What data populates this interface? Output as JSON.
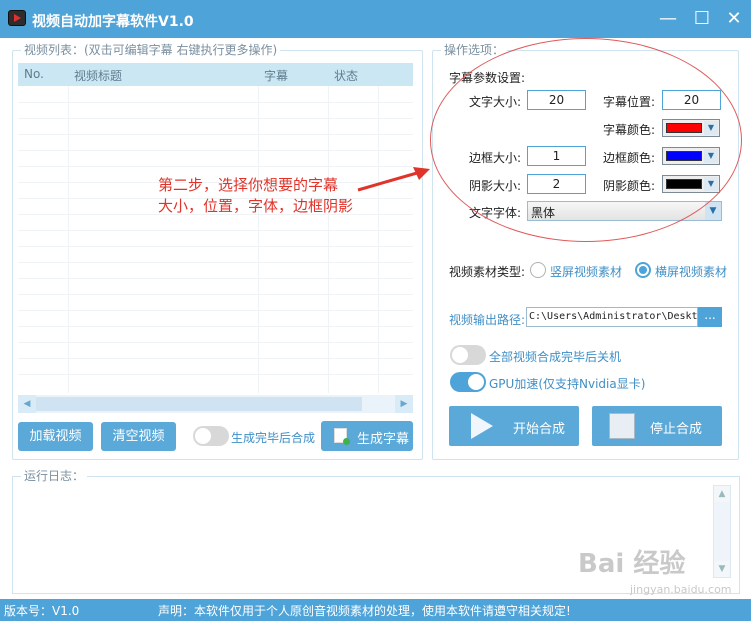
{
  "window": {
    "title": "视频自动加字幕软件V1.0",
    "minimize": "—",
    "maximize": "☐",
    "close": "✕"
  },
  "video_list": {
    "legend": "视频列表：(双击可编辑字幕 右键执行更多操作)",
    "columns": [
      "No.",
      "视频标题",
      "字幕",
      "状态"
    ],
    "rows": []
  },
  "left_actions": {
    "load_button": "加载视频",
    "clear_button": "清空视频",
    "auto_merge_toggle_label": "生成完毕后合成",
    "auto_merge_on": false,
    "generate_button": "生成字幕"
  },
  "options": {
    "legend": "操作选项：",
    "subtitle_params_label": "字幕参数设置:",
    "font_size_label": "文字大小:",
    "font_size_value": "20",
    "position_label": "字幕位置:",
    "position_value": "20",
    "color_label": "字幕颜色:",
    "color_value": "#ff0000",
    "border_size_label": "边框大小:",
    "border_size_value": "1",
    "border_color_label": "边框颜色:",
    "border_color_value": "#0000ff",
    "shadow_size_label": "阴影大小:",
    "shadow_size_value": "2",
    "shadow_color_label": "阴影颜色:",
    "shadow_color_value": "#000000",
    "font_family_label": "文字字体:",
    "font_family_value": "黑体",
    "material_type_label": "视频素材类型:",
    "vertical_option": "竖屏视频素材",
    "horizontal_option": "横屏视频素材",
    "selected_material": "horizontal",
    "output_path_label": "视频输出路径:",
    "output_path_value": "C:\\Users\\Administrator\\Deskt",
    "browse_button": "...",
    "shutdown_toggle_label": "全部视频合成完毕后关机",
    "shutdown_on": false,
    "gpu_toggle_label": "GPU加速(仅支持Nvidia显卡)",
    "gpu_on": true,
    "start_button": "开始合成",
    "stop_button": "停止合成"
  },
  "annotation": {
    "line1": "第二步，选择你想要的字幕",
    "line2": "大小，位置，字体，边框阴影",
    "color": "#e0342b"
  },
  "log": {
    "legend": "运行日志："
  },
  "status_bar": {
    "version": "版本号：V1.0",
    "notice": "声明：本软件仅用于个人原创音视频素材的处理，使用本软件请遵守相关规定!"
  },
  "watermark": {
    "text": "Bai 经验",
    "url": "jingyan.baidu.com"
  },
  "colors": {
    "accent": "#4ea3d8",
    "annotation_red": "#e0342b"
  }
}
